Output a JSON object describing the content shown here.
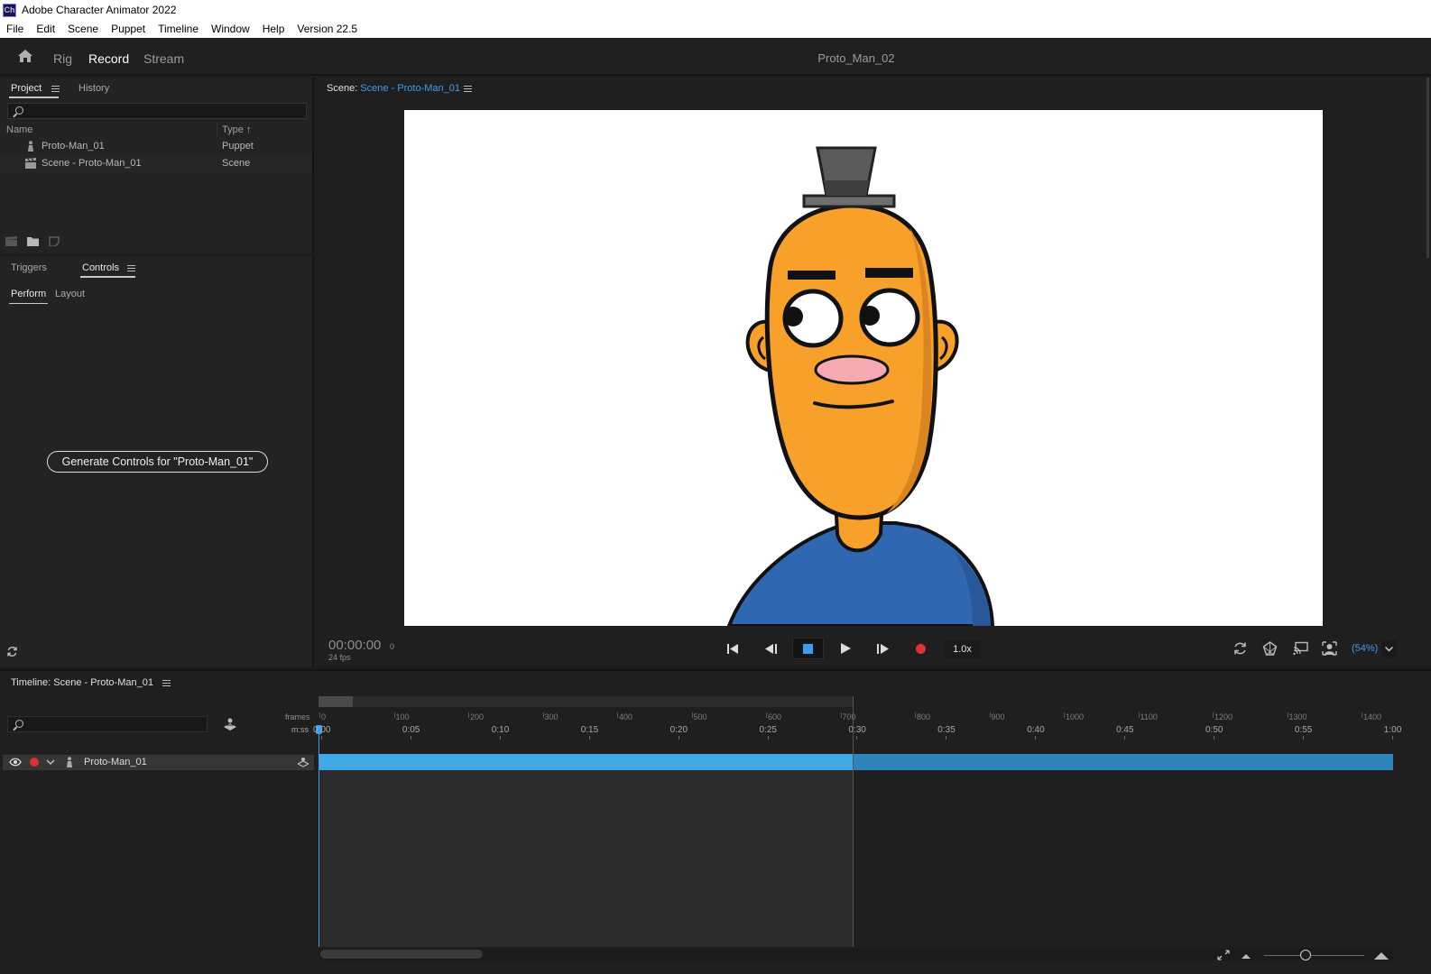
{
  "window": {
    "title": "Adobe Character Animator 2022",
    "app_icon_text": "Ch"
  },
  "menu": {
    "items": [
      "File",
      "Edit",
      "Scene",
      "Puppet",
      "Timeline",
      "Window",
      "Help",
      "Version 22.5"
    ]
  },
  "workspace": {
    "tabs": [
      "Rig",
      "Record",
      "Stream"
    ],
    "active_tab": "Record",
    "document_title": "Proto_Man_02"
  },
  "project_panel": {
    "tabs": [
      "Project",
      "History"
    ],
    "active_tab": "Project",
    "columns": {
      "name": "Name",
      "type": "Type"
    },
    "items": [
      {
        "name": "Proto-Man_01",
        "type": "Puppet",
        "icon": "puppet-icon"
      },
      {
        "name": "Scene - Proto-Man_01",
        "type": "Scene",
        "icon": "scene-clapper-icon"
      }
    ]
  },
  "controls_panel": {
    "tabs": [
      "Triggers",
      "Controls"
    ],
    "active_tab": "Controls",
    "subtabs": [
      "Perform",
      "Layout"
    ],
    "active_subtab": "Perform",
    "generate_button_label": "Generate Controls for \"Proto-Man_01\""
  },
  "scene_panel": {
    "label": "Scene:",
    "scene_name": "Scene - Proto-Man_01",
    "timecode": "00:00:00",
    "frame": "0",
    "fps": "24 fps",
    "speed": "1.0x",
    "zoom": "(54%)"
  },
  "timeline": {
    "title": "Timeline: Scene - Proto-Man_01",
    "frames_label": "frames",
    "mss_label": "m:ss",
    "frame_ticks": [
      "0",
      "100",
      "200",
      "300",
      "400",
      "500",
      "600",
      "700",
      "800",
      "900",
      "1000",
      "1100",
      "1200",
      "1300",
      "1400"
    ],
    "time_ticks": [
      "0:00",
      "0:05",
      "0:10",
      "0:15",
      "0:20",
      "0:25",
      "0:30",
      "0:35",
      "0:40",
      "0:45",
      "0:50",
      "0:55",
      "1:00"
    ],
    "layers": [
      {
        "name": "Proto-Man_01"
      }
    ]
  },
  "colors": {
    "accent": "#3b9cf0",
    "record": "#e03030",
    "track": "#3fa9e6",
    "puppet_skin": "#f7a02a",
    "puppet_shirt": "#2f68b0"
  }
}
